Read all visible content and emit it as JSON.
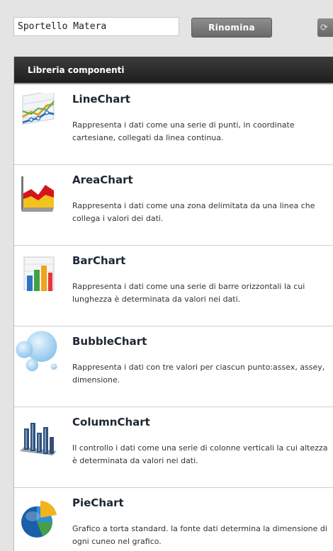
{
  "toolbar": {
    "name_value": "Sportello Matera",
    "rename_label": "Rinomina"
  },
  "library": {
    "header": "Libreria componenti",
    "items": [
      {
        "title": "LineChart",
        "desc": "Rappresenta i dati come una serie di punti, in coordinate cartesiane, collegati da linea continua.",
        "icon": "line-chart-icon"
      },
      {
        "title": "AreaChart",
        "desc": "Rappresenta i dati come una zona delimitata da una linea che collega i valori dei dati.",
        "icon": "area-chart-icon"
      },
      {
        "title": "BarChart",
        "desc": "Rappresenta i dati come una serie di barre orizzontali la cui lunghezza è determinata da valori nei dati.",
        "icon": "bar-chart-icon"
      },
      {
        "title": "BubbleChart",
        "desc": "Rappresenta i dati con tre valori per ciascun punto:assex, assey, dimensione.",
        "icon": "bubble-chart-icon"
      },
      {
        "title": "ColumnChart",
        "desc": "Il controllo i dati come una serie di colonne verticali la cui altezza è determinata da valori nei dati.",
        "icon": "column-chart-icon"
      },
      {
        "title": "PieChart",
        "desc": "Grafico a torta standard. la fonte dati determina la dimensione di ogni cuneo nel grafico.",
        "icon": "pie-chart-icon"
      }
    ]
  }
}
